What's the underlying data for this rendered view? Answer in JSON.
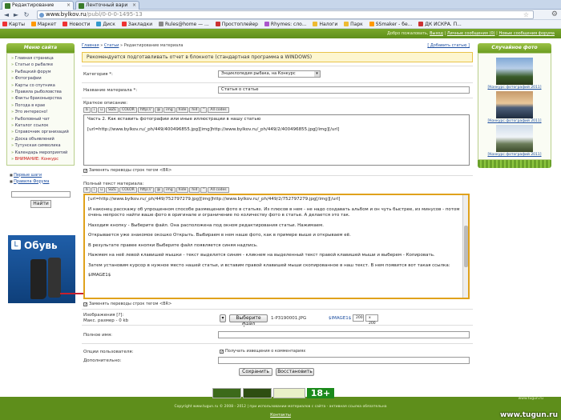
{
  "browser": {
    "tabs": [
      {
        "label": "Редактирование",
        "active": true
      },
      {
        "label": "Ленточный вари",
        "active": false
      }
    ],
    "url_host": "www.bylkov.ru",
    "url_path": "/publ/0-0-0-1495-13",
    "bookmarks": [
      "Карты",
      "Маркет",
      "Новости",
      "Диск",
      "Закладки",
      "Rules@home — ...",
      "Простоплейер",
      "Rhymes: сло...",
      "Налоги",
      "Парк",
      "SSmaker - бе...",
      "ДК ИСКРА. П..."
    ]
  },
  "site": {
    "userline": {
      "greeting": "Добро пожаловать,",
      "exit": "Выход",
      "pm": "Личные сообщения (0)",
      "new": "Новые сообщения форума"
    },
    "left": {
      "heading": "Меню сайта",
      "menu": [
        {
          "label": "Главная страница",
          "hot": false
        },
        {
          "label": "Статьи о рыбалке",
          "hot": false
        },
        {
          "label": "Рыбацкий форум",
          "hot": false
        },
        {
          "label": "Фотографии",
          "hot": false
        },
        {
          "label": "Карты со спутника",
          "hot": false
        },
        {
          "label": "Правила рыболовства",
          "hot": false
        },
        {
          "label": "Факты браконьерства",
          "hot": false
        },
        {
          "label": "Погода в крае",
          "hot": false
        },
        {
          "label": "Это интересно!",
          "hot": false
        },
        {
          "label": "Рыболовный чат",
          "hot": false
        },
        {
          "label": "Каталог ссылок",
          "hot": false
        },
        {
          "label": "Справочник организаций",
          "hot": false
        },
        {
          "label": "Доска объявлений",
          "hot": false
        },
        {
          "label": "Тутунская символика",
          "hot": false
        },
        {
          "label": "Календарь мероприятий",
          "hot": false
        },
        {
          "label": "ВНИМАНИЕ: Конкурс",
          "hot": true
        }
      ],
      "extra": [
        "Первые шаги",
        "Правила Форума"
      ],
      "find_button": "Найти",
      "ad_title": "Обувь"
    },
    "right": {
      "heading": "Случайное фото",
      "captions": [
        "[Конкурс фотографий 2011]",
        "[Конкурс фотографий 2011]",
        "[Конкурс фотографий 2011]"
      ]
    },
    "main": {
      "crumbs": [
        "Главная",
        "Статьи",
        "Редактирование материала"
      ],
      "add_link": "[ Добавить статью ]",
      "warning": "Рекомендуется подготавливать отчет в блокноте (стандартная программа в WINDOWS)",
      "category_label": "Категория *:",
      "category_value": "Энциклопедия рыбака, на Конкурс",
      "title_label": "Название материала *:",
      "title_value": "Статья о статье",
      "short_label": "Краткое описание:",
      "toolbar": [
        "b",
        "i",
        "u",
        "SIZE",
        "COLOR",
        "http://",
        "@",
        "img",
        "hide",
        "hid",
        "\"",
        "All codes"
      ],
      "short_text": [
        "Часть 2. Как вставить фотографии или иные иллюстрации в нашу статью",
        "[url=http://www.bylkov.ru/_ph/449/400496855.jpg][img]http://www.bylkov.ru/_ph/449/2/400496855.jpg[/img][/url]"
      ],
      "replace_label": "Заменять переводы строк тегом <BR>",
      "full_label": "Полный текст материала:",
      "full_text": [
        "[url=http://www.bylkov.ru/_ph/449/752797279.jpg][img]http://www.bylkov.ru/_ph/449/2/752797279.jpg[/img][/url]",
        "И наконец расскажу об упрощенном способе размещения фото в статьях. Из плюсов в нем - не надо создавать альбом и он чуть быстрее, из минусов - потом очень непросто найти ваше фото в оригинале и ограничение по количеству фото в статье. А делается это так.",
        "Находим кнопку - Выберите файл. Она расположена под окном редактирования статьи. Нажимаем.",
        "Открывается уже знакомое окошко Открыть. Выбираем в нем наше фото, как в примере выше и открываем её.",
        "В результате правее кнопки Выберите файл появляется синяя надпись.",
        "Нажмем на неё левой клавишей мышки - текст выделится синим - кликнем на выделенный текст правой клавишей мыши и выберем - Копировать.",
        "Затем установим курсор в нужное место нашей статьи, и вставим правой клавишей мыши скопированное в наш текст. В нем появится вот такая ссылка:",
        "$IMAGE1$"
      ],
      "images_label": "Изображения [?]:",
      "images_sub": "Макс. размер - 0 kb",
      "choose_file": "Выберите файл",
      "file_name": "1-P3190001.JPG",
      "image_tag": "$IMAGE1$",
      "img_w": "200",
      "img_h": "x 200",
      "fullname_label": "Полное имя:",
      "options_label": "Опции пользователя:",
      "notify_label": "Получать извещения о комментариях",
      "extra_label": "Дополнительно:",
      "save": "Сохранить",
      "restore": "Восстановить"
    },
    "footer": {
      "copyright": "Copyright www.tugun.ru © 2008 - 2012 | при использовании материалов с сайта - активная ссылка обязательна",
      "contacts": "Контакты",
      "host": "www.tugun.ru",
      "age": "18+",
      "watermark": "www.tugun.ru"
    }
  }
}
